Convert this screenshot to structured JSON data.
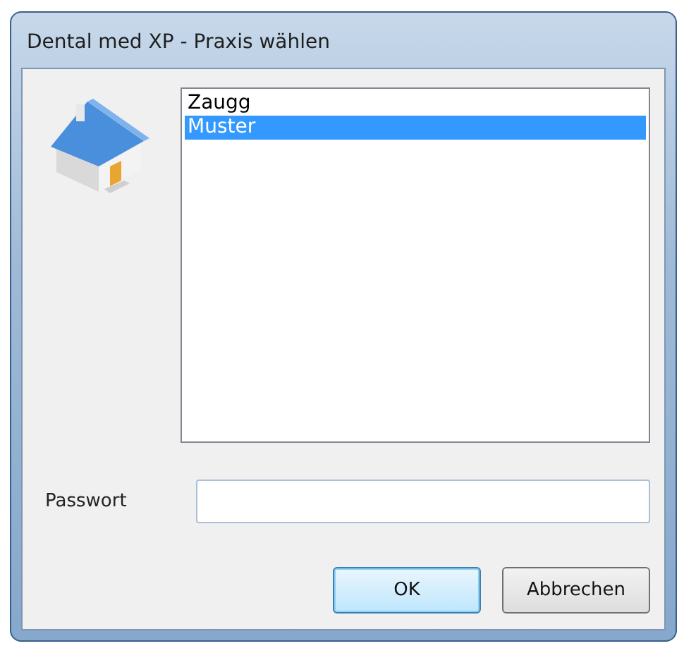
{
  "window": {
    "title": "Dental med XP - Praxis wählen"
  },
  "practices": [
    {
      "label": "Zaugg",
      "selected": false
    },
    {
      "label": "Muster",
      "selected": true
    }
  ],
  "password": {
    "label": "Passwort"
  },
  "buttons": [
    {
      "label": "OK",
      "kind": "default"
    },
    {
      "label": "Abbrechen",
      "kind": "normal"
    }
  ]
}
